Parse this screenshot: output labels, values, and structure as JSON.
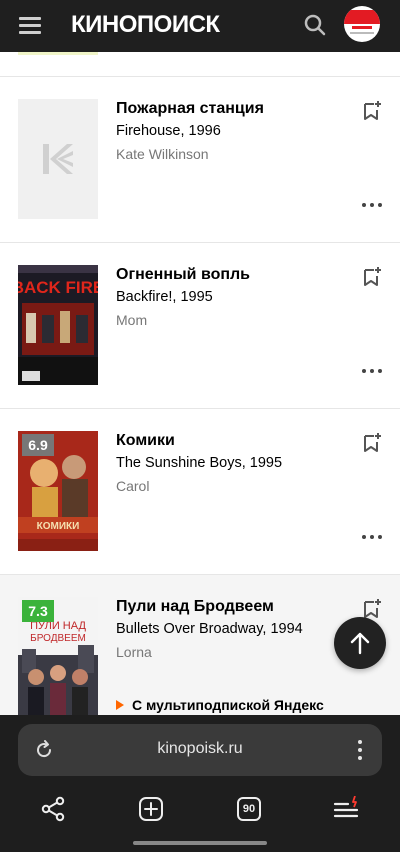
{
  "header": {
    "logo_text": "КИНОПОИСК",
    "brand_color": "#ff5500"
  },
  "items": [
    {
      "title": "Пожарная станция",
      "subtitle": "Firehouse, 1996",
      "role": "Kate Wilkinson",
      "poster": "placeholder"
    },
    {
      "title": "Огненный вопль",
      "subtitle": "Backfire!, 1995",
      "role": "Mom",
      "poster_text": "BACK FIRE"
    },
    {
      "title": "Комики",
      "subtitle": "The Sunshine Boys, 1995",
      "role": "Carol",
      "rating": "6.9",
      "rating_color": "#777777",
      "poster_text": "КОМИКИ"
    },
    {
      "title": "Пули над Бродвеем",
      "subtitle": "Bullets Over Broadway, 1994",
      "role": "Lorna",
      "rating": "7.3",
      "rating_color": "#3bb33b",
      "poster_text": "ПУЛИ НАД БРОДВЕЕМ",
      "promo": "С мультиподпиской Яндекс"
    }
  ],
  "browser": {
    "url": "kinopoisk.ru",
    "tabs_count": "90"
  },
  "icons": {
    "menu": "hamburger-icon",
    "search": "search-icon",
    "bookmark": "bookmark-add-icon",
    "more": "more-dots-icon",
    "scroll_top": "arrow-up-icon",
    "reload": "reload-icon",
    "share": "share-icon",
    "new_tab": "plus-square-icon",
    "tabs": "tabs-icon",
    "browser_menu": "menu-sparkle-icon"
  }
}
